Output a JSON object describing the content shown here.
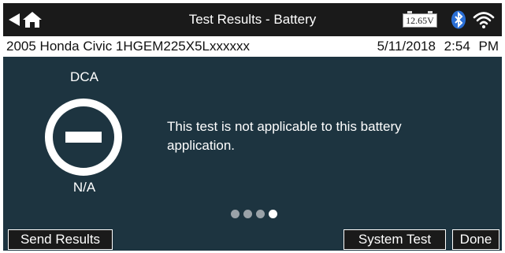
{
  "titlebar": {
    "title": "Test Results - Battery",
    "battery_voltage": "12.65V"
  },
  "infobar": {
    "vehicle": "2005 Honda Civic 1HGEM225X5Lxxxxxx",
    "datetime": "5/11/2018 2:54 PM"
  },
  "result": {
    "test_type": "DCA",
    "value": "N/A",
    "message": "This test is not applicable to this battery application."
  },
  "pager": {
    "total": 4,
    "active_index": 4
  },
  "buttons": {
    "send_results": "Send Results",
    "system_test": "System Test",
    "done": "Done"
  },
  "colors": {
    "background": "#1d3440",
    "titlebar": "#1a1a1a",
    "bluetooth": "#2a6fd6",
    "text": "#ffffff"
  },
  "icons": [
    "back-arrow-icon",
    "home-icon",
    "vehicle-battery-icon",
    "bluetooth-icon",
    "wifi-icon",
    "not-applicable-icon"
  ]
}
